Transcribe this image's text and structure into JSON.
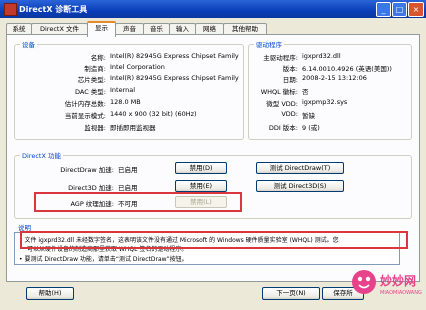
{
  "window": {
    "title": "DirectX 诊断工具"
  },
  "tabs": [
    "系统",
    "DirectX 文件",
    "显示",
    "声音",
    "音乐",
    "输入",
    "网络",
    "其他帮助"
  ],
  "device": {
    "legend": "设备",
    "rows": [
      {
        "label": "名称:",
        "value": "Intel(R) 82945G Express Chipset Family"
      },
      {
        "label": "制造商:",
        "value": "Intel Corporation"
      },
      {
        "label": "芯片类型:",
        "value": "Intel(R) 82945G Express Chipset Family"
      },
      {
        "label": "DAC 类型:",
        "value": "Internal"
      },
      {
        "label": "估计内存总数:",
        "value": "128.0 MB"
      },
      {
        "label": "当前显示模式:",
        "value": "1440 x 900 (32 bit) (60Hz)"
      },
      {
        "label": "监视器:",
        "value": "即插即用监视器"
      }
    ]
  },
  "driver": {
    "legend": "驱动程序",
    "rows": [
      {
        "label": "主驱动程序:",
        "value": "igxprd32.dll"
      },
      {
        "label": "版本:",
        "value": "6.14.0010.4926 (英语(美国))"
      },
      {
        "label": "日期:",
        "value": "2008-2-15 13:12:06"
      },
      {
        "label": "WHQL 徽标:",
        "value": "否"
      },
      {
        "label": "微型 VDD:",
        "value": "igxpmp32.sys"
      },
      {
        "label": "VDD:",
        "value": "暂缺"
      },
      {
        "label": "DDI 版本:",
        "value": "9 (或)"
      }
    ]
  },
  "directx": {
    "legend": "DirectX 功能",
    "rows": [
      {
        "label": "DirectDraw 加速:",
        "status": "已启用",
        "button": "禁用(D)",
        "test": "测试 DirectDraw(T)"
      },
      {
        "label": "Direct3D 加速:",
        "status": "已启用",
        "button": "禁用(E)",
        "test": "测试 Direct3D(S)"
      },
      {
        "label": "AGP 纹理加速:",
        "status": "不可用",
        "button": "禁用(L)"
      }
    ]
  },
  "notes": {
    "legend": "说明",
    "items": [
      "文件 igxprd32.dll 未经数字签名，这表明该文件没有通过 Microsoft 的 Windows 硬件质量实验室 (WHQL) 测试。您",
      "可以从硬件设备的制造商那里获取 WHQL 签名的驱动程序。",
      "要测试 DirectDraw 功能，请单击“测试 DirectDraw”按钮。"
    ]
  },
  "footer": {
    "help": "帮助(H)",
    "next": "下一页(N)",
    "save": "保存所"
  },
  "watermark": {
    "name": "妙妙网",
    "domain": "MIAOMIAOWANG"
  },
  "colors": {
    "accent": "#0046d5",
    "highlight": "#d9363e"
  }
}
